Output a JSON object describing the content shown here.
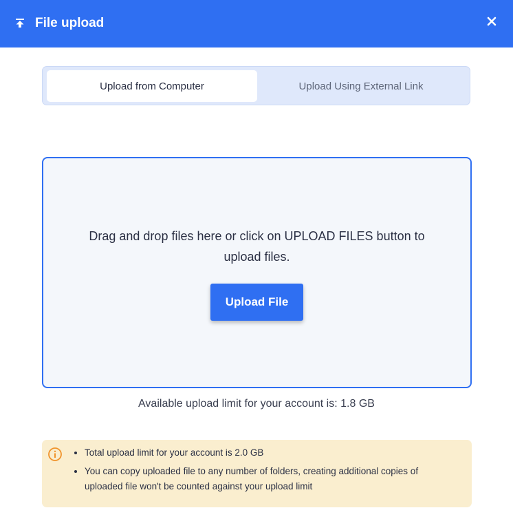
{
  "dialog": {
    "title": "File upload",
    "header_icon": "upload-icon",
    "close_icon": "close-icon",
    "accent_color": "#2f6ff2"
  },
  "tabs": [
    {
      "label": "Upload from Computer",
      "selected": true
    },
    {
      "label": "Upload Using External Link",
      "selected": false
    }
  ],
  "dropzone": {
    "text": "Drag and drop files here or click on UPLOAD FILES button to upload files.",
    "button_label": "Upload File"
  },
  "available_limit_text": "Available upload limit for your account is: 1.8 GB",
  "notice": {
    "icon": "info-icon",
    "items": [
      "Total upload limit for your account is 2.0 GB",
      "You can copy uploaded file to any number of folders, creating additional copies of uploaded file won't be counted against your upload limit"
    ]
  }
}
